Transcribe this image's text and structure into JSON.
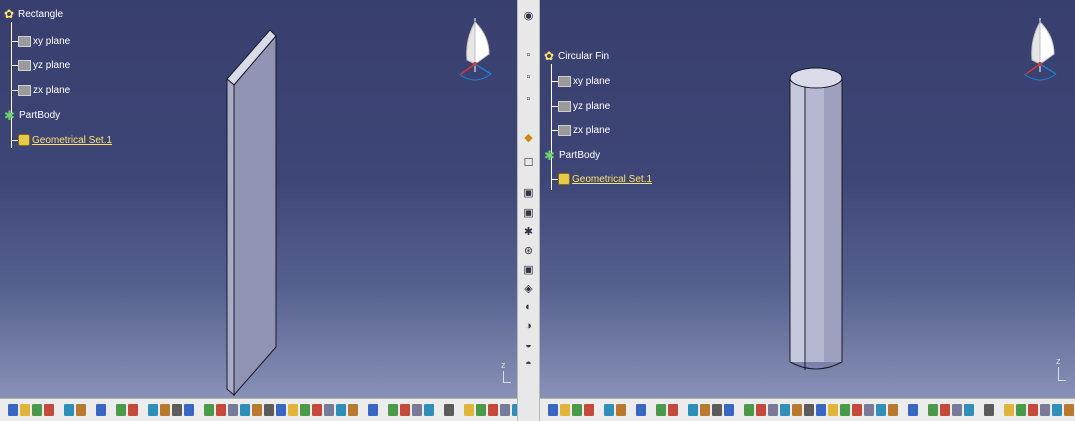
{
  "left_window": {
    "tree": {
      "root": "Rectangle",
      "planes": [
        "xy plane",
        "yz plane",
        "zx plane"
      ],
      "body": "PartBody",
      "geo_set": "Geometrical Set.1"
    }
  },
  "right_window": {
    "tree": {
      "root": "Circular Fin",
      "planes": [
        "xy plane",
        "yz plane",
        "zx plane"
      ],
      "body": "PartBody",
      "geo_set": "Geometrical Set.1"
    }
  },
  "axis_labels": {
    "z": "z",
    "x": "x"
  },
  "icons": {
    "compass": "compass-icon",
    "tree_root": "part-icon",
    "plane": "plane-icon",
    "body": "partbody-icon",
    "geo_set": "geometrical-set-icon"
  },
  "colors": {
    "viewport_top": "#383f6e",
    "viewport_bottom": "#8891b6",
    "tree_text": "#ffffff",
    "geo_text": "#ffe36a",
    "solid_face": "#bfc2d8",
    "solid_side": "#8e91ad"
  }
}
